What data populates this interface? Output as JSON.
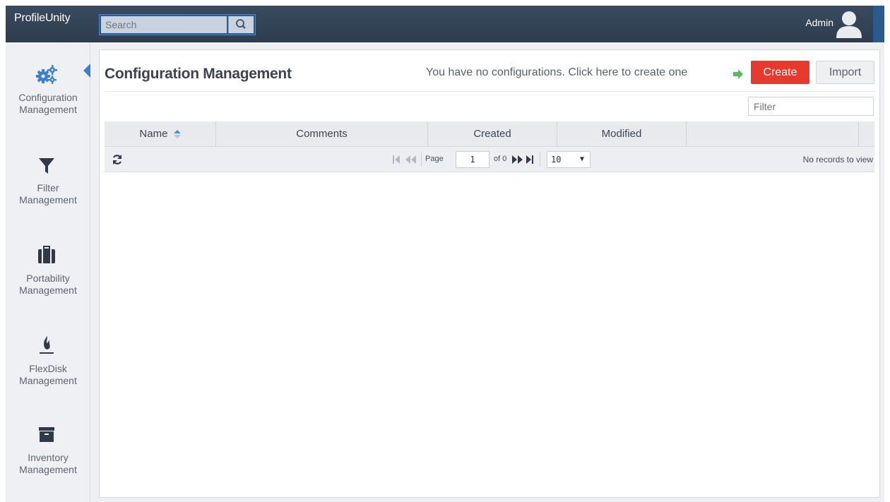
{
  "app": {
    "brand": "ProfileUnity"
  },
  "search": {
    "placeholder": "Search"
  },
  "user": {
    "name": "Admin"
  },
  "sidebar": {
    "items": [
      {
        "line1": "Configuration",
        "line2": "Management",
        "icon": "gears-icon",
        "active": true
      },
      {
        "line1": "Filter",
        "line2": "Management",
        "icon": "filter-icon"
      },
      {
        "line1": "Portability",
        "line2": "Management",
        "icon": "suitcase-icon"
      },
      {
        "line1": "FlexDisk",
        "line2": "Management",
        "icon": "flexdisk-icon"
      },
      {
        "line1": "Inventory",
        "line2": "Management",
        "icon": "archive-icon"
      }
    ]
  },
  "main": {
    "title": "Configuration Management",
    "hint": "You have no configurations. Click here to create one",
    "create_label": "Create",
    "import_label": "Import",
    "filter_placeholder": "Filter"
  },
  "grid": {
    "columns": [
      "Name",
      "Comments",
      "Created",
      "Modified",
      ""
    ],
    "sorted_column": "Name"
  },
  "pager": {
    "page_label": "Page",
    "page_value": "1",
    "of_label": "of 0",
    "rows_per_page": "10",
    "records_text": "No records to view"
  },
  "colors": {
    "topbar": "#2e3d4f",
    "accent_blue": "#3a7fd5",
    "create_red": "#e8392f",
    "arrow_green": "#5cb85c"
  }
}
